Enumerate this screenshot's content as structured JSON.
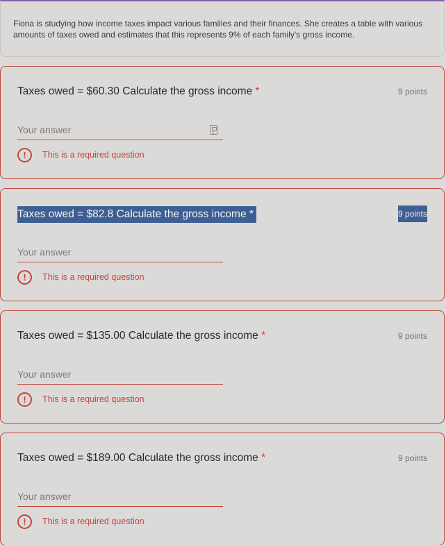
{
  "intro": {
    "text": "Fiona is studying how income taxes impact various families and their finances. She creates a table with various amounts of taxes owed and estimates that this represents 9% of each family's gross income."
  },
  "questions": [
    {
      "title": "Taxes owed = $60.30 Calculate the gross income",
      "required_mark": "*",
      "points": "9 points",
      "placeholder": "Your answer",
      "error": "This is a required question",
      "error_icon": "!"
    },
    {
      "title": "Taxes owed = $82.8 Calculate the gross income",
      "required_mark": "*",
      "points": "9 points",
      "placeholder": "Your answer",
      "error": "This is a required question",
      "error_icon": "!"
    },
    {
      "title": "Taxes owed = $135.00 Calculate the gross income",
      "required_mark": "*",
      "points": "9 points",
      "placeholder": "Your answer",
      "error": "This is a required question",
      "error_icon": "!"
    },
    {
      "title": "Taxes owed = $189.00 Calculate the gross income",
      "required_mark": "*",
      "points": "9 points",
      "placeholder": "Your answer",
      "error": "This is a required question",
      "error_icon": "!"
    }
  ],
  "colors": {
    "background": "#dcdad8",
    "error": "#c0463b",
    "selection": "#3d5f93",
    "accent": "#7f5fa5"
  }
}
